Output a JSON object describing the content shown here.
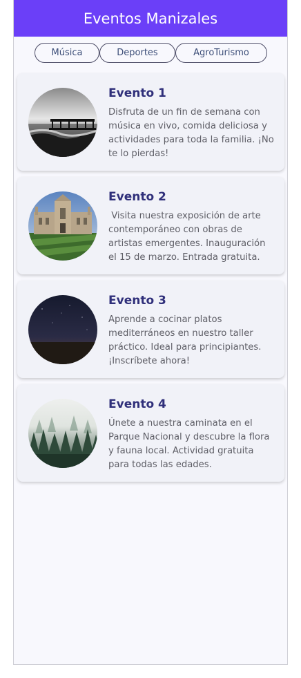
{
  "header": {
    "title": "Eventos Manizales"
  },
  "filters": [
    {
      "label": "Música"
    },
    {
      "label": "Deportes"
    },
    {
      "label": "AgroTurismo"
    }
  ],
  "events": [
    {
      "title": "Evento 1",
      "description": "Disfruta de un fin de semana con música en vivo, comida deliciosa y actividades para toda la familia. ¡No te lo pierdas!",
      "image": "pier-over-sea-bw"
    },
    {
      "title": "Evento 2",
      "description": " Visita nuestra exposición de arte contemporáneo con obras de artistas emergentes. Inauguración el 15 de marzo. Entrada gratuita.",
      "image": "gothic-college-building"
    },
    {
      "title": "Evento 3",
      "description": "Aprende a cocinar platos mediterráneos en nuestro taller práctico. Ideal para principiantes. ¡Inscríbete ahora!",
      "image": "night-sky-horizon"
    },
    {
      "title": "Evento 4",
      "description": "Únete a nuestra caminata en el Parque Nacional y descubre la flora y fauna local. Actividad gratuita para todas las edades.",
      "image": "misty-pine-forest"
    }
  ],
  "colors": {
    "header_bg": "#6b3ff8",
    "card_bg": "#f1f2f8",
    "title": "#2f2f7a",
    "text": "#5e5e66"
  }
}
